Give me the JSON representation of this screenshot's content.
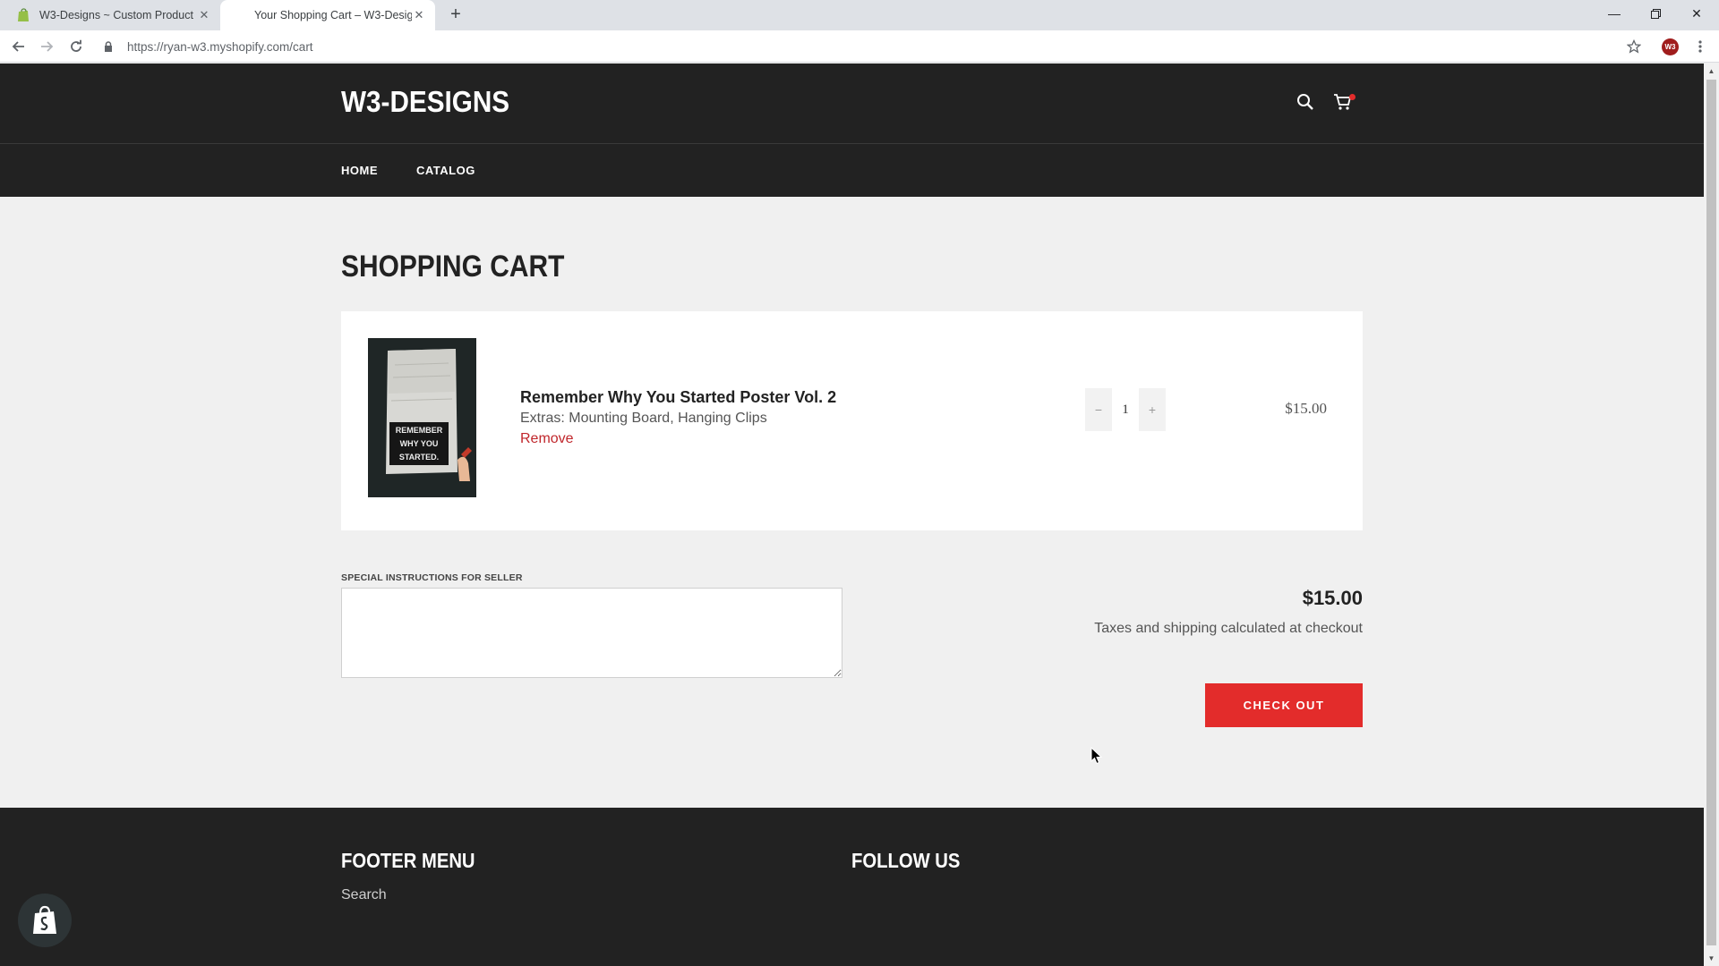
{
  "browser": {
    "tabs": [
      {
        "title": "W3-Designs ~ Custom Product Options",
        "active": false
      },
      {
        "title": "Your Shopping Cart – W3-Designs",
        "active": true
      }
    ],
    "url": "https://ryan-w3.myshopify.com/cart",
    "profile_initials": "W3"
  },
  "header": {
    "logo": "W3-DESIGNS",
    "nav": [
      "HOME",
      "CATALOG"
    ]
  },
  "cart": {
    "title": "SHOPPING CART",
    "items": [
      {
        "name": "Remember Why You Started Poster Vol. 2",
        "extras": "Extras: Mounting Board, Hanging Clips",
        "remove_label": "Remove",
        "quantity": "1",
        "minus": "−",
        "plus": "+",
        "price": "$15.00",
        "poster_text": [
          "REMEMBER",
          "WHY YOU",
          "STARTED."
        ]
      }
    ],
    "instructions_label": "SPECIAL INSTRUCTIONS FOR SELLER",
    "subtotal": "$15.00",
    "tax_note": "Taxes and shipping calculated at checkout",
    "checkout_label": "CHECK OUT"
  },
  "footer": {
    "menu_heading": "FOOTER MENU",
    "menu_links": [
      "Search"
    ],
    "follow_heading": "FOLLOW US"
  },
  "colors": {
    "header_bg": "#222222",
    "accent": "#e32c2b",
    "page_bg": "#f0f0f0"
  }
}
